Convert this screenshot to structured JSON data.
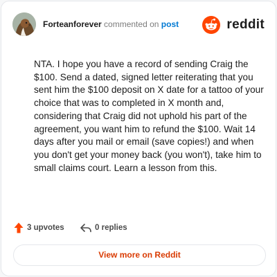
{
  "comment": {
    "username": "Forteanforever",
    "action_text": "commented on",
    "post_link": "post",
    "body": "NTA. I hope you have a record of sending Craig the $100. Send a dated, signed letter reiterating that you sent him the $100 deposit on X date for a tattoo of your choice that was to completed in X month and, considering that Craig did not uphold his part of the agreement, you want him to refund the $100. Wait 14 days after you mail or email (save copies!) and when you don't get your money back (you won't), take him to small claims court. Learn a lesson from this."
  },
  "brand": {
    "wordmark": "reddit",
    "logo_icon": "reddit-snoo-icon",
    "accent": "#ff4500"
  },
  "stats": {
    "upvotes": "3 upvotes",
    "upvote_icon": "upvote-arrow-icon",
    "replies": "0 replies",
    "reply_icon": "reply-arrow-icon"
  },
  "footer": {
    "button_label": "View more on Reddit",
    "button_color": "#d93a00"
  }
}
